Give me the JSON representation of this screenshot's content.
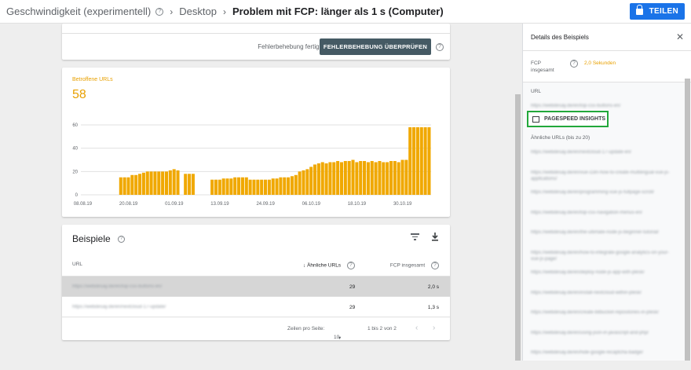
{
  "topbar": {
    "crumb1": "Geschwindigkeit (experimentell)",
    "crumb2": "Desktop",
    "current": "Problem mit FCP: länger als 1 s (Computer)",
    "share_label": "TEILEN"
  },
  "fix": {
    "question": "Fehlerbehebung fertig?",
    "button": "FEHLERBEHEBUNG ÜBERPRÜFEN"
  },
  "chart_card": {
    "label": "Betroffene URLs",
    "count": "58"
  },
  "chart_data": {
    "type": "bar",
    "title": "Betroffene URLs",
    "x_tick_labels": [
      "08.08.19",
      "20.08.19",
      "01.09.19",
      "13.09.19",
      "24.09.19",
      "06.10.19",
      "18.10.19",
      "30.10.19"
    ],
    "y_tick_labels": [
      "60",
      "40",
      "20",
      "0"
    ],
    "ylim": [
      0,
      60
    ],
    "start_date": "08.08.19",
    "values": [
      0,
      0,
      0,
      0,
      0,
      0,
      0,
      0,
      0,
      0,
      15,
      15,
      15,
      17,
      17,
      18,
      19,
      20,
      20,
      20,
      20,
      20,
      20,
      21,
      22,
      21,
      0,
      18,
      18,
      18,
      0,
      0,
      0,
      0,
      13,
      13,
      13,
      14,
      14,
      14,
      15,
      15,
      15,
      15,
      13,
      13,
      13,
      13,
      13,
      13,
      14,
      14,
      15,
      15,
      15,
      16,
      17,
      20,
      21,
      22,
      24,
      26,
      27,
      28,
      27,
      28,
      28,
      29,
      28,
      29,
      29,
      30,
      28,
      29,
      29,
      28,
      29,
      28,
      29,
      28,
      28,
      29,
      29,
      28,
      30,
      30,
      58,
      58,
      58,
      58,
      58,
      58
    ],
    "color": "#f0a800",
    "grid": true
  },
  "examples": {
    "title": "Beispiele",
    "col_url": "URL",
    "col_similar": "Ähnliche URLs",
    "col_fcp": "FCP insgesamt",
    "rows": [
      {
        "url": "https://webdesay.de/en/top-css-buttons-en/",
        "similar": "29",
        "fcp": "2,0 s"
      },
      {
        "url": "https://webdesay.de/en/nextcloud-17-update/",
        "similar": "29",
        "fcp": "1,3 s"
      }
    ],
    "rows_per_page_label": "Zeilen pro Seite:",
    "rows_per_page": "10",
    "range": "1 bis 2 von 2"
  },
  "panel": {
    "title": "Details des Beispiels",
    "fcp_label_1": "FCP",
    "fcp_label_2": "insgesamt",
    "fcp_value": "2,0 Sekunden",
    "url_heading": "URL",
    "url_value": "https://webdesay.de/en/top-css-buttons-en/",
    "pagespeed_button": "PAGESPEED INSIGHTS",
    "similar_heading": "Ähnliche URLs (bis zu 20)",
    "similar_urls": [
      "https://webdesay.de/en/nextcloud-17-update-en/",
      "https://webdesay.de/en/vue-i18n-how-to-create-multilingual-vue-js-applications/",
      "https://webdesay.de/en/programming-vue-js-fullpage-scroll/",
      "https://webdesay.de/en/top-css-navigation-menus-en/",
      "https://webdesay.de/en/the-ultimate-node-js-beginner-tutorial/",
      "https://webdesay.de/en/how-to-integrate-google-analytics-on-your-vue-js-page/",
      "https://webdesay.de/en/deploy-node-js-app-with-plesk/",
      "https://webdesay.de/en/install-nextcloud-within-plesk/",
      "https://webdesay.de/en/create-bitbucket-repositories-in-plesk/",
      "https://webdesay.de/en/using-json-in-javascript-and-php/",
      "https://webdesay.de/en/hide-google-recaptcha-badge/"
    ]
  }
}
